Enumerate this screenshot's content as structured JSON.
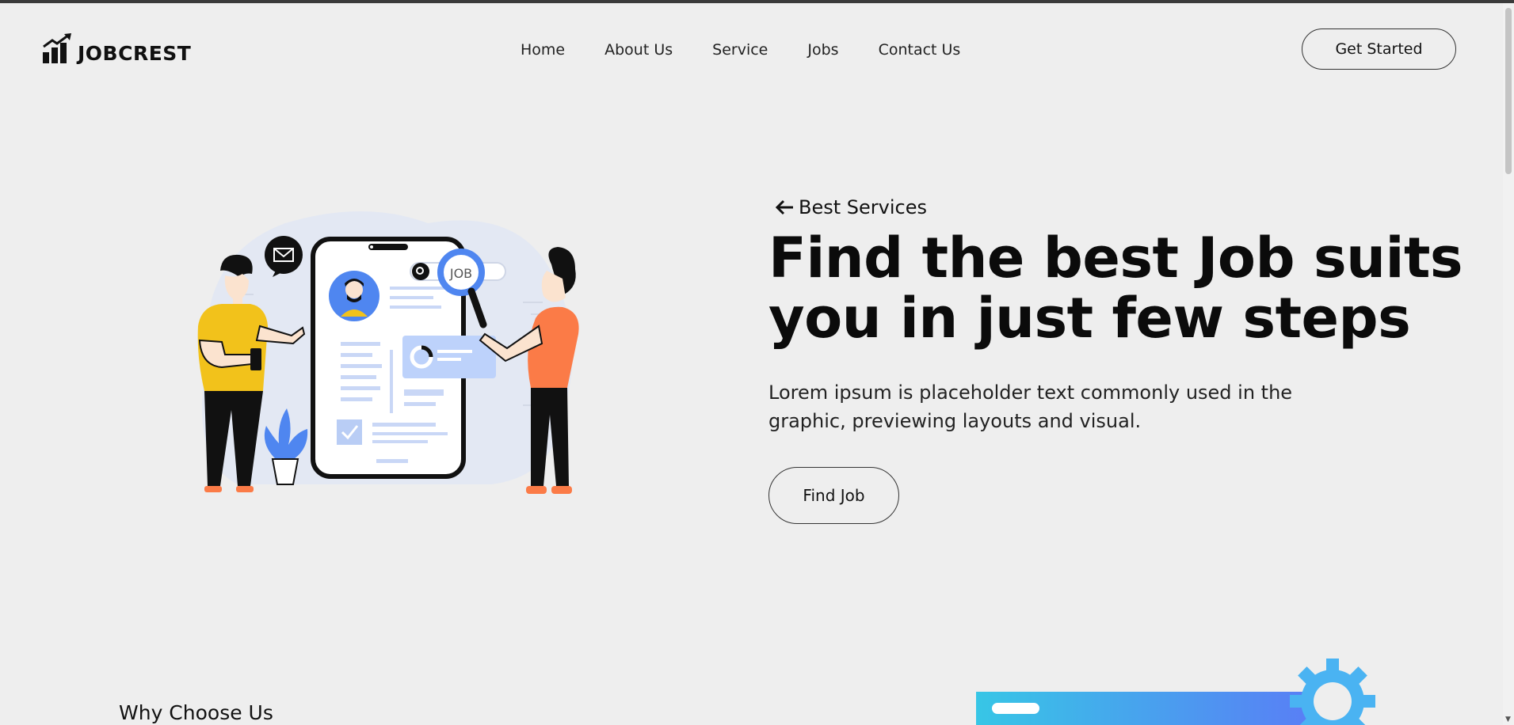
{
  "brand": {
    "name": "JOBCREST",
    "logo_icon": "bar-chart-growth-icon"
  },
  "nav": {
    "items": [
      {
        "label": "Home"
      },
      {
        "label": "About Us"
      },
      {
        "label": "Service"
      },
      {
        "label": "Jobs"
      },
      {
        "label": "Contact Us"
      }
    ],
    "cta_label": "Get Started"
  },
  "hero": {
    "tagline": "Best Services",
    "tagline_icon": "arrow-left-icon",
    "title_line1": "Find the best Job suits",
    "title_line2": "you in just few steps",
    "description": "Lorem ipsum is placeholder text commonly used in the graphic, previewing layouts and visual.",
    "button_label": "Find Job",
    "illustration": {
      "search_badge_text": "JOB"
    }
  },
  "why_section": {
    "heading": "Why Choose Us"
  },
  "colors": {
    "background": "#eeeeee",
    "text": "#111111",
    "accent_blue": "#4f86f0",
    "accent_yellow": "#f2c21b",
    "accent_orange": "#fb7b47",
    "illustration_bg": "#e3e8f3"
  }
}
